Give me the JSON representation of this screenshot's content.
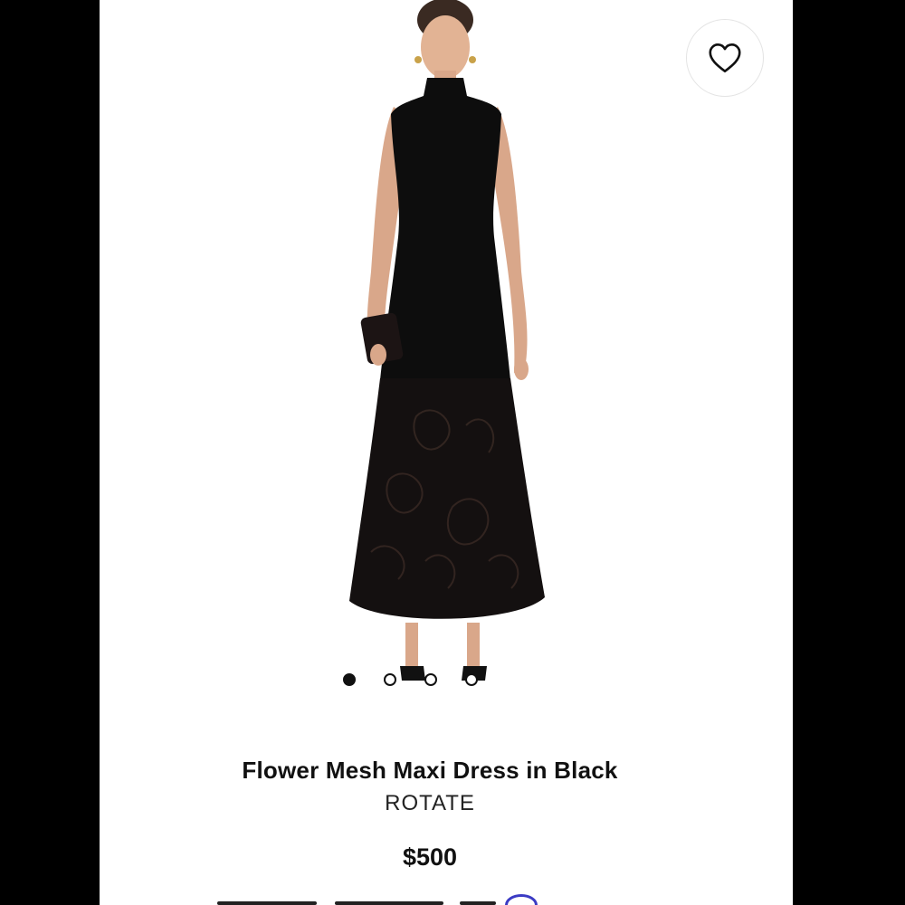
{
  "product": {
    "title": "Flower Mesh Maxi Dress in Black",
    "brand": "ROTATE",
    "price": "$500"
  },
  "gallery": {
    "image_count": 4,
    "active_index": 0,
    "wishlist_icon": "heart-icon"
  },
  "colors": {
    "background": "#ffffff",
    "text": "#111111",
    "dress": "#0d0d0d",
    "skin": "#d9a78a",
    "accent_ring": "#3b3bc4"
  }
}
